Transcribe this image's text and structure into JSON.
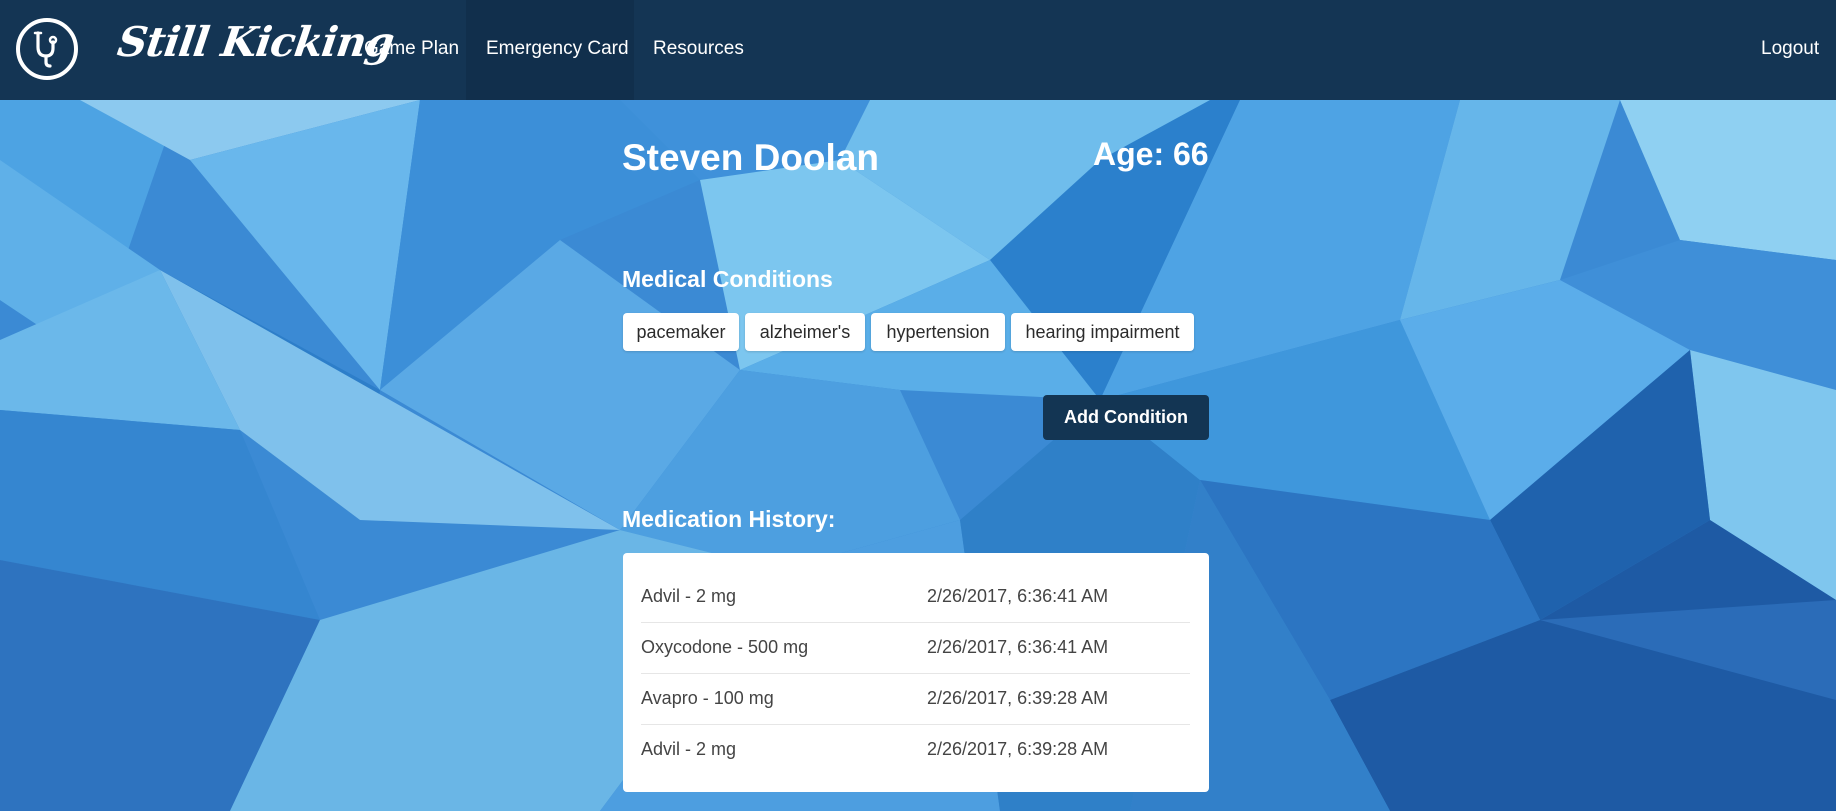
{
  "nav": {
    "brand": "Still Kicking",
    "links": [
      {
        "label": "Game Plan",
        "active": false
      },
      {
        "label": "Emergency Card",
        "active": true
      },
      {
        "label": "Resources",
        "active": false
      }
    ],
    "logout": "Logout"
  },
  "patient": {
    "name": "Steven Doolan",
    "age_label": "Age: 66"
  },
  "conditions": {
    "title": "Medical Conditions",
    "tags": [
      "pacemaker",
      "alzheimer's",
      "hypertension",
      "hearing impairment"
    ],
    "add_button": "Add Condition"
  },
  "medications": {
    "title": "Medication History:",
    "rows": [
      {
        "name": "Advil - 2 mg",
        "time": "2/26/2017, 6:36:41 AM"
      },
      {
        "name": "Oxycodone - 500 mg",
        "time": "2/26/2017, 6:36:41 AM"
      },
      {
        "name": "Avapro - 100 mg",
        "time": "2/26/2017, 6:39:28 AM"
      },
      {
        "name": "Advil - 2 mg",
        "time": "2/26/2017, 6:39:28 AM"
      }
    ]
  },
  "icons": {
    "logo": "stethoscope-icon"
  },
  "colors": {
    "navbar": "#143554",
    "navbar_active": "#112f4c",
    "button": "#133553",
    "background": "#3f8fd6"
  }
}
